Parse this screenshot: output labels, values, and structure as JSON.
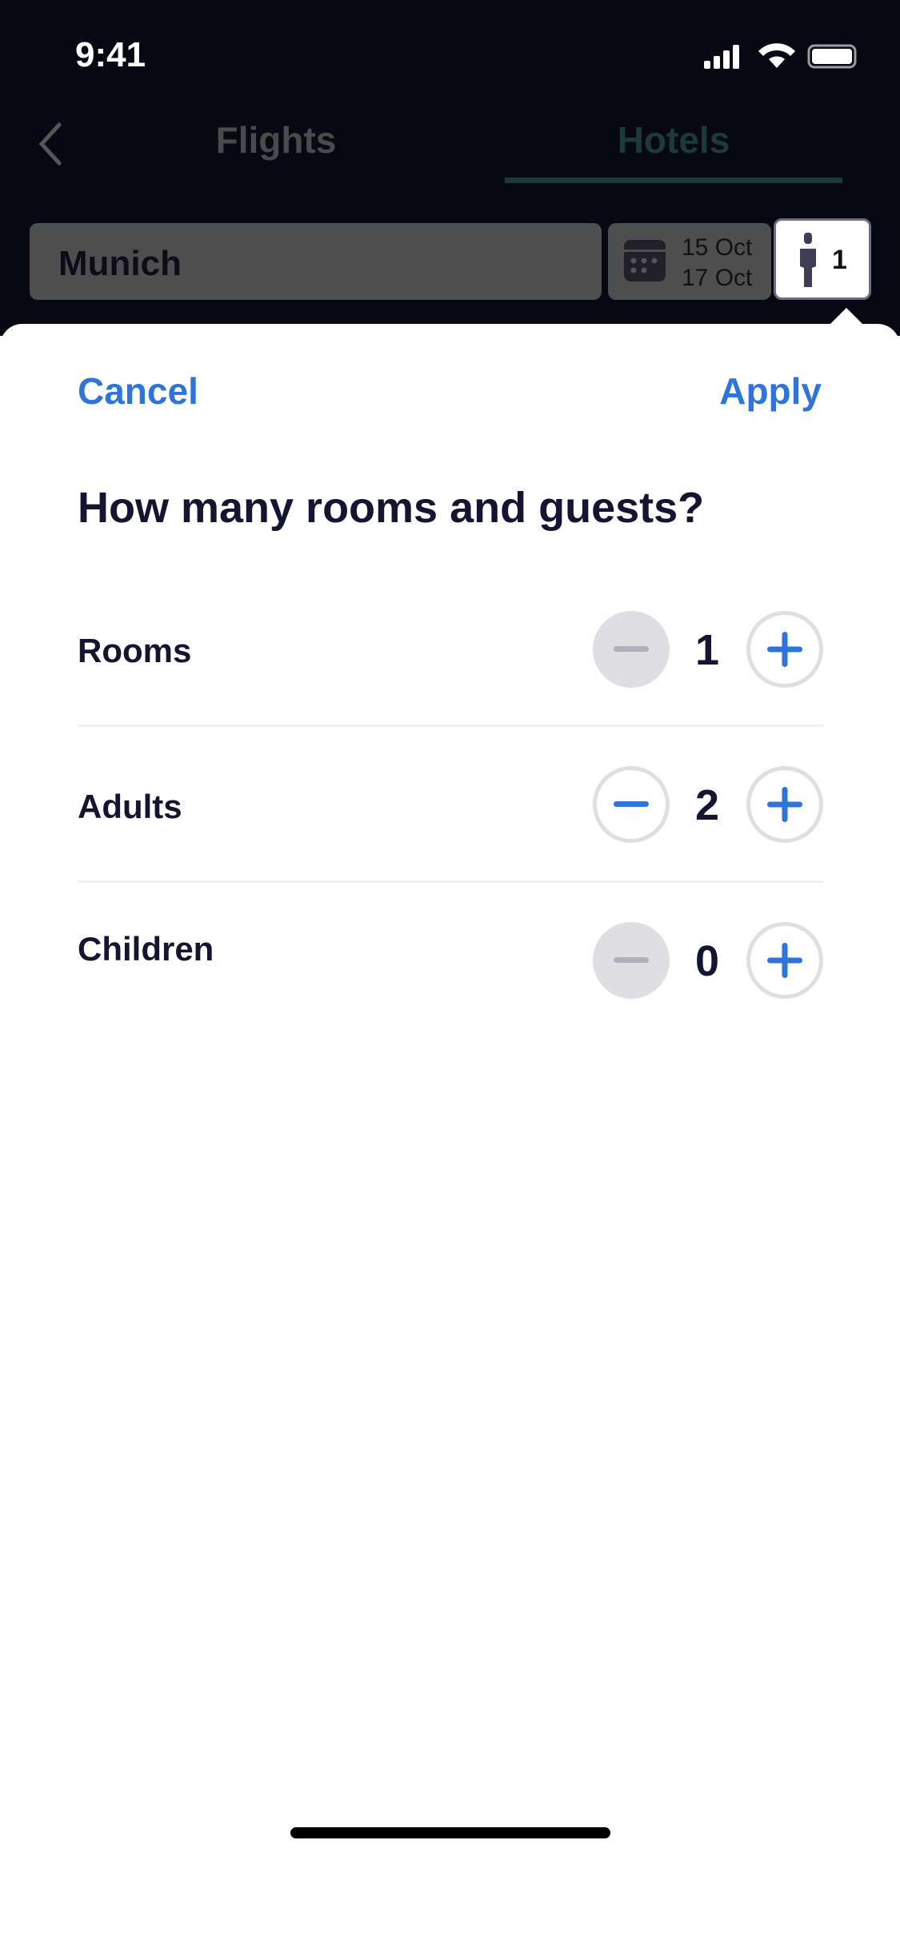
{
  "status": {
    "time": "9:41"
  },
  "nav": {
    "tabs": [
      {
        "label": "Flights",
        "active": false
      },
      {
        "label": "Hotels",
        "active": true
      }
    ]
  },
  "search": {
    "destination": "Munich",
    "checkin": "15 Oct",
    "checkout": "17 Oct",
    "guests": "1"
  },
  "sheet": {
    "cancel": "Cancel",
    "apply": "Apply",
    "title": "How many rooms and guests?",
    "rows": [
      {
        "label": "Rooms",
        "value": "1",
        "minus_enabled": false
      },
      {
        "label": "Adults",
        "value": "2",
        "minus_enabled": true
      },
      {
        "label": "Children",
        "value": "0",
        "minus_enabled": false
      }
    ]
  },
  "colors": {
    "accent": "#2f73dc",
    "active_tab": "#1d3a38",
    "text": "#141531"
  }
}
